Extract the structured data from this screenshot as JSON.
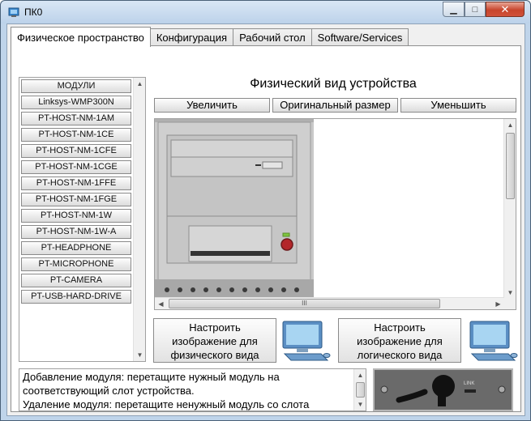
{
  "window": {
    "title": "ПК0"
  },
  "tabs": [
    {
      "label": "Физическое пространство"
    },
    {
      "label": "Конфигурация"
    },
    {
      "label": "Рабочий стол"
    },
    {
      "label": "Software/Services"
    }
  ],
  "modules": {
    "items": [
      "МОДУЛИ",
      "Linksys-WMP300N",
      "PT-HOST-NM-1AM",
      "PT-HOST-NM-1CE",
      "PT-HOST-NM-1CFE",
      "PT-HOST-NM-1CGE",
      "PT-HOST-NM-1FFE",
      "PT-HOST-NM-1FGE",
      "PT-HOST-NM-1W",
      "PT-HOST-NM-1W-A",
      "PT-HEADPHONE",
      "PT-MICROPHONE",
      "PT-CAMERA",
      "PT-USB-HARD-DRIVE"
    ]
  },
  "view": {
    "title": "Физический вид устройства",
    "zoom_in": "Увеличить",
    "original_size": "Оригинальный размер",
    "zoom_out": "Уменьшить",
    "scroll_grip": "III"
  },
  "custom": {
    "physical_line1": "Настроить",
    "physical_line2": "изображение для",
    "physical_line3": "физического вида",
    "logical_line1": "Настроить",
    "logical_line2": "изображение для",
    "logical_line3": "логического вида"
  },
  "help": {
    "line1": "Добавление модуля: перетащите нужный модуль на",
    "line2": " соответствующий слот устройства.",
    "line3": "Удаление модуля: перетащите ненужный модуль со слота"
  },
  "module_image": {
    "port_label": "LINK"
  },
  "colors": {
    "window_frame": "#bfd4ea",
    "close_button": "#c8452d",
    "computer_case": "#c9c9c9",
    "power_led": "#7ec63f",
    "power_button": "#b3262a"
  }
}
